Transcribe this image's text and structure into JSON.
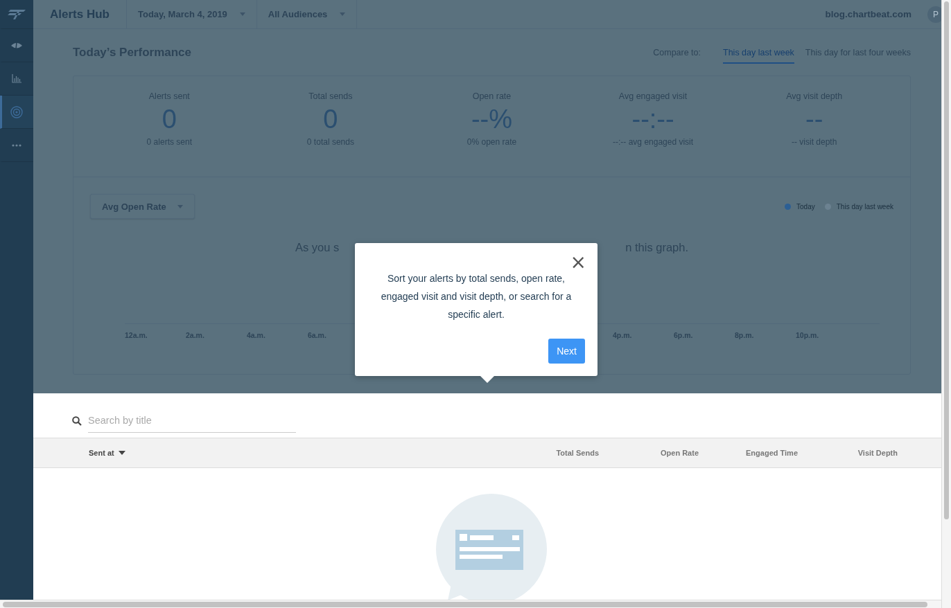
{
  "sidebar": {
    "items": [
      {
        "kind": "logo",
        "selected": false
      },
      {
        "kind": "eye",
        "selected": false
      },
      {
        "kind": "bars",
        "selected": false
      },
      {
        "kind": "target",
        "selected": true
      },
      {
        "kind": "more",
        "selected": false
      }
    ]
  },
  "header": {
    "title": "Alerts Hub",
    "date_dropdown": "Today, March 4, 2019",
    "audience_dropdown": "All Audiences",
    "domain": "blog.chartbeat.com",
    "avatar": "P"
  },
  "performance": {
    "title": "Today’s Performance",
    "compare_label": "Compare to:",
    "compare_tabs": [
      {
        "label": "This day last week",
        "selected": true
      },
      {
        "label": "This day for last four weeks",
        "selected": false
      }
    ],
    "stats": [
      {
        "label": "Alerts sent",
        "value": "0",
        "caption": "0 alerts sent"
      },
      {
        "label": "Total sends",
        "value": "0",
        "caption": "0 total sends"
      },
      {
        "label": "Open rate",
        "value": "--%",
        "caption": "0% open rate"
      },
      {
        "label": "Avg engaged visit",
        "value": "--:--",
        "caption": "--:-- avg engaged visit"
      },
      {
        "label": "Avg visit depth",
        "value": "--",
        "caption": "-- visit depth"
      }
    ],
    "metric_dropdown": "Avg Open Rate",
    "legend": [
      {
        "label": "Today",
        "color": "#2c5f94"
      },
      {
        "label": "This day last week",
        "color": "#6c8291"
      }
    ],
    "empty_message_start": "As you s",
    "empty_message_end": "n this graph.",
    "axis_labels_left": [
      "12a.m.",
      "2a.m.",
      "4a.m.",
      "6a.m."
    ],
    "axis_labels_right": [
      "4p.m.",
      "6p.m.",
      "8p.m.",
      "10p.m."
    ]
  },
  "popover": {
    "text": "Sort your alerts by total sends, open rate, engaged visit and visit depth, or search for a specific alert.",
    "close": "×",
    "button": "Next"
  },
  "search": {
    "placeholder": "Search by title"
  },
  "table": {
    "columns": [
      {
        "label": "Sent at",
        "sorted": true
      },
      {
        "label": "Total Sends",
        "sorted": false
      },
      {
        "label": "Open Rate",
        "sorted": false
      },
      {
        "label": "Engaged Time",
        "sorted": false
      },
      {
        "label": "Visit Depth",
        "sorted": false
      }
    ]
  }
}
